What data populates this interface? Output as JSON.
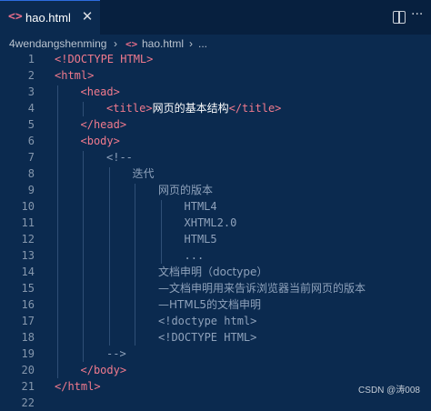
{
  "tab": {
    "icon": "html-file-icon",
    "icon_text": "<>",
    "label": "hao.html",
    "close": "✕"
  },
  "header_icons": {
    "split": "split-editor-icon",
    "more": "···"
  },
  "breadcrumb": {
    "folder": "4wendangshenming",
    "sep": "›",
    "file_icon": "<>",
    "file": "hao.html",
    "sep2": "›",
    "trail": "..."
  },
  "lines": [
    {
      "n": "1",
      "indent": 0,
      "parts": [
        [
          "tag",
          "<!DOCTYPE HTML>"
        ]
      ]
    },
    {
      "n": "2",
      "indent": 0,
      "parts": [
        [
          "tag",
          "<html>"
        ]
      ]
    },
    {
      "n": "3",
      "indent": 1,
      "parts": [
        [
          "tag",
          "<head>"
        ]
      ]
    },
    {
      "n": "4",
      "indent": 2,
      "parts": [
        [
          "tag",
          "<title>"
        ],
        [
          "txt",
          "网页的基本结构"
        ],
        [
          "tag",
          "</title>"
        ]
      ]
    },
    {
      "n": "5",
      "indent": 1,
      "parts": [
        [
          "tag",
          "</head>"
        ]
      ]
    },
    {
      "n": "6",
      "indent": 1,
      "parts": [
        [
          "tag",
          "<body>"
        ]
      ]
    },
    {
      "n": "7",
      "indent": 2,
      "parts": [
        [
          "cmt",
          "<!--"
        ]
      ]
    },
    {
      "n": "8",
      "indent": 3,
      "parts": [
        [
          "cmt",
          "迭代"
        ]
      ]
    },
    {
      "n": "9",
      "indent": 4,
      "parts": [
        [
          "cmt",
          "网页的版本"
        ]
      ]
    },
    {
      "n": "10",
      "indent": 5,
      "parts": [
        [
          "cmt",
          "HTML4"
        ]
      ]
    },
    {
      "n": "11",
      "indent": 5,
      "parts": [
        [
          "cmt",
          "XHTML2.0"
        ]
      ]
    },
    {
      "n": "12",
      "indent": 5,
      "parts": [
        [
          "cmt",
          "HTML5"
        ]
      ]
    },
    {
      "n": "13",
      "indent": 5,
      "parts": [
        [
          "cmt",
          "..."
        ]
      ]
    },
    {
      "n": "14",
      "indent": 4,
      "parts": [
        [
          "cmt",
          "文档申明（doctype）"
        ]
      ]
    },
    {
      "n": "15",
      "indent": 4,
      "parts": [
        [
          "cmt",
          "—文档申明用来告诉浏览器当前网页的版本"
        ]
      ]
    },
    {
      "n": "16",
      "indent": 4,
      "parts": [
        [
          "cmt",
          "—HTML5的文档申明"
        ]
      ]
    },
    {
      "n": "17",
      "indent": 4,
      "parts": [
        [
          "cmt",
          "<!doctype html>"
        ]
      ]
    },
    {
      "n": "18",
      "indent": 4,
      "parts": [
        [
          "cmt",
          "<!DOCTYPE HTML>"
        ]
      ]
    },
    {
      "n": "19",
      "indent": 2,
      "parts": [
        [
          "cmt",
          "-->"
        ]
      ]
    },
    {
      "n": "20",
      "indent": 1,
      "parts": [
        [
          "tag",
          "</body>"
        ]
      ]
    },
    {
      "n": "21",
      "indent": 0,
      "parts": [
        [
          "tag",
          "</html>"
        ]
      ]
    },
    {
      "n": "22",
      "indent": 0,
      "parts": []
    }
  ],
  "watermark": "CSDN @涛008",
  "colors": {
    "background": "#0b2a4f",
    "tag": "#f07a8d",
    "comment": "#8fa2bb",
    "text": "#ffffff",
    "line_number": "#8597ad"
  }
}
